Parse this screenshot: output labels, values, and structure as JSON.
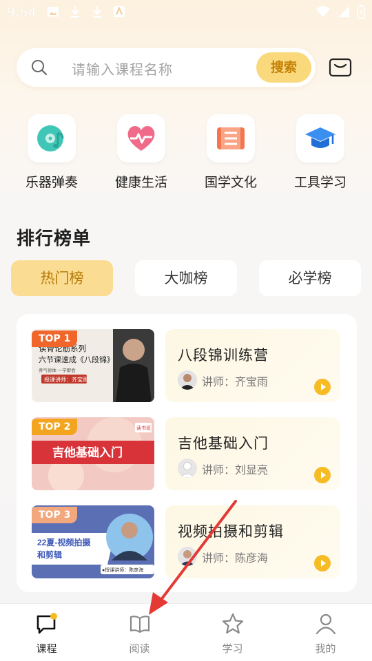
{
  "status_bar": {
    "time": "9:54",
    "left_icons": [
      "image-icon",
      "download-icon",
      "download-icon",
      "app-icon"
    ],
    "right_icons": [
      "wifi-icon",
      "signal-icon",
      "battery-charging-icon"
    ]
  },
  "search": {
    "placeholder": "请输入课程名称",
    "button_label": "搜索",
    "icon": "search-icon",
    "mail_icon": "mail-icon"
  },
  "categories": [
    {
      "label": "乐器弹奏",
      "icon": "music-disc-icon",
      "color": "#3fc6b6"
    },
    {
      "label": "健康生活",
      "icon": "heart-pulse-icon",
      "color": "#f06a8a"
    },
    {
      "label": "国学文化",
      "icon": "scroll-icon",
      "color": "#f2774f"
    },
    {
      "label": "工具学习",
      "icon": "graduation-cap-icon",
      "color": "#3b8ff0"
    }
  ],
  "rank": {
    "title": "排行榜单",
    "tabs": [
      {
        "label": "热门榜",
        "active": true
      },
      {
        "label": "大咖榜",
        "active": false
      },
      {
        "label": "必学榜",
        "active": false
      }
    ]
  },
  "courses": [
    {
      "badge": "TOP 1",
      "badge_color": "#f0662b",
      "thumb_lines": [
        "读骨论筋系列",
        "六节课速成《八段锦》",
        "养气修体 一学即会",
        "授课讲师：齐宝雨"
      ],
      "title": "八段锦训练营",
      "teacher": "讲师：齐宝雨"
    },
    {
      "badge": "TOP 2",
      "badge_color": "#f3a51f",
      "thumb_lines": [
        "吉他基础入门",
        "读书班"
      ],
      "title": "吉他基础入门",
      "teacher": "讲师：刘显亮"
    },
    {
      "badge": "TOP 3",
      "badge_color": "#f2a77d",
      "thumb_lines": [
        "22夏-视频拍摄",
        "和剪辑",
        "●授课讲师：陈彦海"
      ],
      "title": "视频拍摄和剪辑",
      "teacher": "讲师：陈彦海"
    }
  ],
  "bottom_nav": [
    {
      "label": "课程",
      "icon": "course-chat-icon",
      "active": true
    },
    {
      "label": "阅读",
      "icon": "book-open-icon",
      "active": false
    },
    {
      "label": "学习",
      "icon": "star-icon",
      "active": false
    },
    {
      "label": "我的",
      "icon": "user-icon",
      "active": false
    }
  ],
  "colors": {
    "accent": "#fad97d",
    "accent_text": "#c48208",
    "annotation_arrow": "#e53935"
  }
}
